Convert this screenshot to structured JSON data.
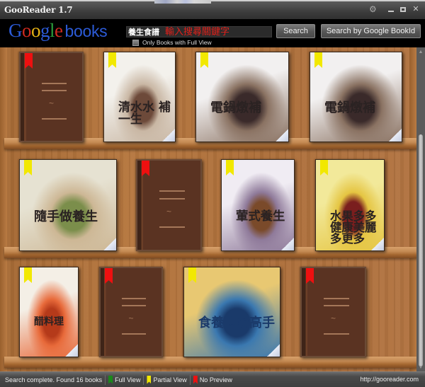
{
  "window": {
    "title": "GooReader 1.7",
    "controls": [
      {
        "name": "settings",
        "icon": "gear-icon"
      },
      {
        "name": "minimize",
        "icon": "minimize-icon"
      },
      {
        "name": "maximize",
        "icon": "maximize-icon"
      },
      {
        "name": "close",
        "icon": "close-icon"
      }
    ]
  },
  "header": {
    "logo": {
      "google": [
        "G",
        "o",
        "o",
        "g",
        "l",
        "e"
      ],
      "books": "books"
    },
    "search": {
      "value": "養生食譜",
      "hint": "輸入搜尋關鍵字"
    },
    "full_view_only": {
      "label": "Only Books with Full View",
      "checked": false
    },
    "search_button": "Search",
    "bookid_button": "Search by Google BookId"
  },
  "legend_colors": {
    "full": "#1a8a1a",
    "partial": "#f2e800",
    "none": "#ee1010"
  },
  "shelves": [
    {
      "books": [
        {
          "availability": "none",
          "cover": "blank"
        },
        {
          "availability": "partial",
          "cover": "image",
          "title": "清水水 補一生",
          "palette": [
            "#f3f1ec",
            "#c9b7a4",
            "#6d4a3a"
          ]
        },
        {
          "availability": "partial",
          "cover": "image",
          "title": "電鍋燉補",
          "palette": [
            "#f2f0f0",
            "#8a7262",
            "#3a2a2a"
          ]
        },
        {
          "availability": "partial",
          "cover": "image",
          "title": "電鍋燉補",
          "palette": [
            "#f2f0f0",
            "#8a7262",
            "#3a2a2a"
          ]
        }
      ]
    },
    {
      "books": [
        {
          "availability": "partial",
          "cover": "image",
          "title": "隨手做養生",
          "palette": [
            "#e6e2d2",
            "#cdb795",
            "#7b8e4b"
          ]
        },
        {
          "availability": "none",
          "cover": "blank"
        },
        {
          "availability": "partial",
          "cover": "image",
          "title": "葷式養生",
          "palette": [
            "#f0ecf3",
            "#8f7a9a",
            "#7a4a2a"
          ]
        },
        {
          "availability": "partial",
          "cover": "image",
          "title": "水果多多 健康美麗多更多",
          "palette": [
            "#f2e99a",
            "#e5c542",
            "#7a1e1e"
          ]
        }
      ]
    },
    {
      "books": [
        {
          "availability": "partial",
          "cover": "image",
          "title": "醋料理",
          "palette": [
            "#f4efe6",
            "#e86a3a",
            "#b53a1a"
          ]
        },
        {
          "availability": "none",
          "cover": "blank"
        },
        {
          "availability": "partial",
          "cover": "image",
          "title": "食養食療高手",
          "palette": [
            "#e8c872",
            "#3a78b0",
            "#1a3a6a"
          ]
        },
        {
          "availability": "none",
          "cover": "blank"
        }
      ]
    }
  ],
  "status": {
    "message": "Search complete. Found 16 books",
    "legend": [
      {
        "key": "full",
        "label": "Full View"
      },
      {
        "key": "partial",
        "label": "Partial View"
      },
      {
        "key": "none",
        "label": "No Preview"
      }
    ],
    "url": "http://gooreader.com"
  }
}
